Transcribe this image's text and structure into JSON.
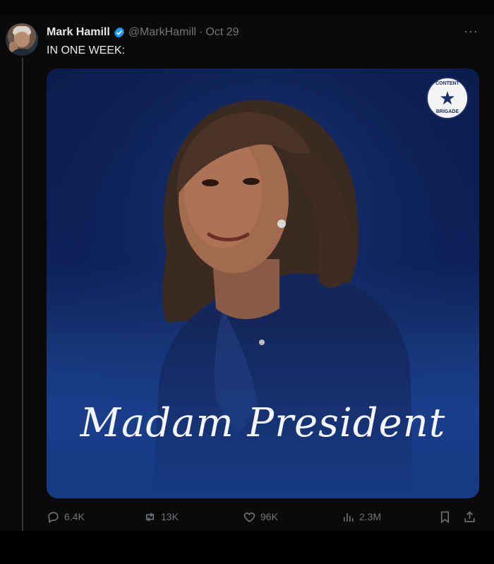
{
  "tweet": {
    "author_name": "Mark Hamill",
    "handle": "@MarkHamill",
    "separator": "·",
    "date": "Oct 29",
    "text": "IN ONE WEEK:",
    "more_label": "···"
  },
  "media": {
    "script_text": "Madam President",
    "badge_top": "CONTENT",
    "badge_bottom": "BRIGADE",
    "badge_star": "★"
  },
  "actions": {
    "replies": "6.4K",
    "reposts": "13K",
    "likes": "96K",
    "views": "2.3M"
  },
  "icons": {
    "verified": "verified-badge-icon",
    "reply": "reply-icon",
    "repost": "repost-icon",
    "like": "heart-icon",
    "views": "bar-chart-icon",
    "bookmark": "bookmark-icon",
    "share": "share-icon"
  },
  "colors": {
    "background": "#000000",
    "text": "#e7e9ea",
    "muted": "#71767b",
    "verified": "#1d9bf0",
    "image_blue": "#1b3f8c"
  }
}
